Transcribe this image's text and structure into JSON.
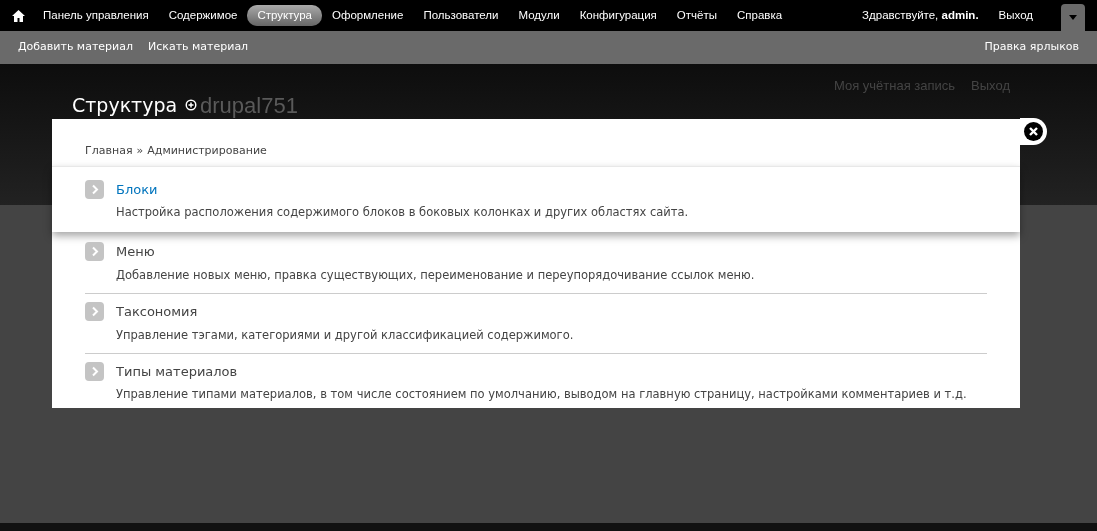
{
  "toolbar": {
    "menu": [
      {
        "label": "Панель управления",
        "selected": false
      },
      {
        "label": "Содержимое",
        "selected": false
      },
      {
        "label": "Структура",
        "selected": true
      },
      {
        "label": "Оформление",
        "selected": false
      },
      {
        "label": "Пользователи",
        "selected": false
      },
      {
        "label": "Модули",
        "selected": false
      },
      {
        "label": "Конфигурация",
        "selected": false
      },
      {
        "label": "Отчёты",
        "selected": false
      },
      {
        "label": "Справка",
        "selected": false
      }
    ],
    "greeting": "Здравствуйте, **admin.**",
    "logout": "Выход",
    "drawer_open": true
  },
  "shortcuts": {
    "items": [
      "Добавить материал",
      "Искать материал"
    ],
    "edit": "Правка ярлыков"
  },
  "site": {
    "name": "drupal751",
    "secondary_menu": [
      "Моя учётная запись",
      "Выход"
    ]
  },
  "overlay": {
    "title": "Структура",
    "breadcrumb": [
      "Главная",
      "Администрирование"
    ],
    "separator": "»",
    "items": [
      {
        "title": "Блоки",
        "description": "Настройка расположения содержимого блоков в боковых колонках и других областях сайта.",
        "selected": true
      },
      {
        "title": "Меню",
        "description": "Добавление новых меню, правка существующих, переименование и переупорядочивание ссылок меню.",
        "selected": false
      },
      {
        "title": "Таксономия",
        "description": "Управление тэгами, категориями и другой классификацией содержимого.",
        "selected": false
      },
      {
        "title": "Типы материалов",
        "description": "Управление типами материалов, в том числе состоянием по умолчанию, выводом на главную страницу, настройками комментариев и т.д.",
        "selected": false
      }
    ]
  }
}
